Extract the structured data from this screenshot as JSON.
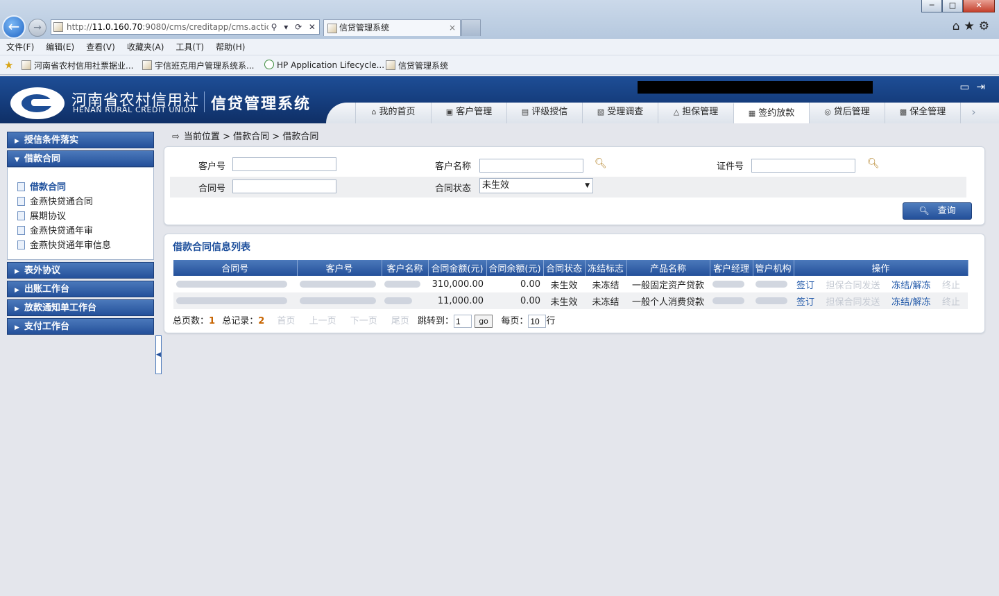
{
  "browser": {
    "url": "http://11.0.160.70:9080/cms/creditapp/cms.actic",
    "url_host": "11.0.160.70",
    "url_prefix": "http://",
    "url_rest": ":9080/cms/creditapp/cms.actic",
    "tab_title": "信贷管理系统",
    "tab_close": "×",
    "window_buttons": {
      "minimize": "─",
      "maximize": "□",
      "close": "✕"
    },
    "addr_icons": "⚲ ▾ ⟳ ✕",
    "right_icons": "⌂★⚙",
    "menu": [
      "文件(F)",
      "编辑(E)",
      "查看(V)",
      "收藏夹(A)",
      "工具(T)",
      "帮助(H)"
    ],
    "favorites": [
      "河南省农村信用社票据业...",
      "宇信班克用户管理系统系...",
      "HP Application Lifecycle...",
      "信贷管理系统"
    ]
  },
  "header": {
    "bank_name_cn": "河南省农村信用社",
    "bank_name_en": "HENAN RURAL CREDIT UNION",
    "system_name": "信贷管理系统",
    "nav_tabs": [
      {
        "label": "我的首页",
        "icon": "home-icon"
      },
      {
        "label": "客户管理",
        "icon": "customer-icon"
      },
      {
        "label": "评级授信",
        "icon": "rating-icon"
      },
      {
        "label": "受理调查",
        "icon": "survey-icon"
      },
      {
        "label": "担保管理",
        "icon": "guarantee-icon"
      },
      {
        "label": "签约放款",
        "icon": "contract-icon"
      },
      {
        "label": "贷后管理",
        "icon": "postloan-icon"
      },
      {
        "label": "保全管理",
        "icon": "preserve-icon"
      }
    ],
    "active_tab": "签约放款"
  },
  "sidebar": {
    "groups": [
      {
        "label": "授信条件落实",
        "expanded": false
      },
      {
        "label": "借款合同",
        "expanded": true,
        "items": [
          "借款合同",
          "金燕快贷通合同",
          "展期协议",
          "金燕快贷通年审",
          "金燕快贷通年审信息"
        ]
      },
      {
        "label": "表外协议",
        "expanded": false
      },
      {
        "label": "出账工作台",
        "expanded": false
      },
      {
        "label": "放款通知单工作台",
        "expanded": false
      },
      {
        "label": "支付工作台",
        "expanded": false
      }
    ],
    "active_item": "借款合同"
  },
  "breadcrumb": {
    "label": "当前位置",
    "path": [
      "借款合同",
      "借款合同"
    ],
    "separator": ">"
  },
  "search": {
    "customer_no_label": "客户号",
    "customer_name_label": "客户名称",
    "id_no_label": "证件号",
    "contract_no_label": "合同号",
    "contract_status_label": "合同状态",
    "contract_status_value": "未生效",
    "query_button": "查询"
  },
  "list": {
    "title": "借款合同信息列表",
    "columns": [
      "合同号",
      "客户号",
      "客户名称",
      "合同金额(元)",
      "合同余额(元)",
      "合同状态",
      "冻结标志",
      "产品名称",
      "客户经理",
      "管户机构",
      "操作"
    ],
    "rows": [
      {
        "amount": "310,000.00",
        "balance": "0.00",
        "status": "未生效",
        "freeze": "未冻结",
        "product": "一般固定资产贷款",
        "ops": [
          "签订",
          "担保合同发送",
          "冻结/解冻",
          "终止"
        ]
      },
      {
        "amount": "11,000.00",
        "balance": "0.00",
        "status": "未生效",
        "freeze": "未冻结",
        "product": "一般个人消费贷款",
        "ops": [
          "签订",
          "担保合同发送",
          "冻结/解冻",
          "终止"
        ]
      }
    ],
    "pager": {
      "total_pages_label": "总页数：",
      "total_pages": "1",
      "total_records_label": "总记录：",
      "total_records": "2",
      "first": "首页",
      "prev": "上一页",
      "next": "下一页",
      "last": "尾页",
      "jump_label": "跳转到：",
      "jump_value": "1",
      "go": "go",
      "per_page_label": "每页：",
      "per_page_value": "10",
      "per_page_unit": "行"
    }
  }
}
